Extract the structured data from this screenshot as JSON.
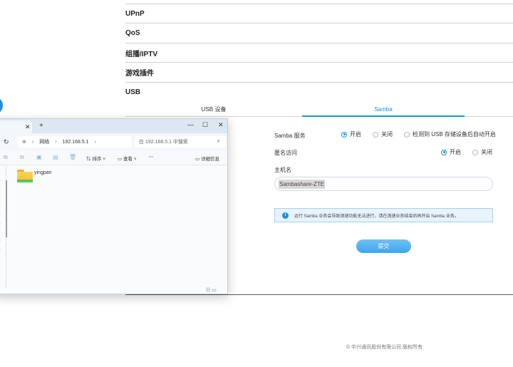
{
  "router": {
    "menu": [
      "UPnP",
      "QoS",
      "组播/IPTV",
      "游戏插件",
      "USB"
    ],
    "tabs": {
      "usb": "USB 设备",
      "samba": "Samba"
    },
    "samba_service": {
      "label": "Samba 服务",
      "options": [
        "开启",
        "关闭",
        "检测到 USB 存储设备后自动开启"
      ],
      "selected": "开启"
    },
    "anonymous": {
      "label": "匿名访问",
      "options": [
        "开启",
        "关闭"
      ],
      "selected": "开启"
    },
    "hostname": {
      "label": "主机名",
      "value": "Sambashare-ZTE"
    },
    "info_text": "运行 Samba 业务会导致测速功能无法进行，请在测速业务结束后再开启 Samba 业务。",
    "submit_label": "提交",
    "footer": "© 中兴通讯股份有限公司 版权所有",
    "accent_color": "#1e8fe0"
  },
  "explorer": {
    "tab_close": "✕",
    "tab_new": "+",
    "window_controls": {
      "minimize": "—",
      "maximize": "☐",
      "close": "✕"
    },
    "breadcrumb": [
      "网络",
      "192.168.5.1"
    ],
    "search_placeholder": "在 192.168.5.1 中搜索",
    "toolbar": {
      "sort": "排序",
      "view": "查看",
      "more": "···",
      "details": "详细信息"
    },
    "items": [
      {
        "name": "yingpan",
        "icon": "folder-icon"
      }
    ]
  }
}
